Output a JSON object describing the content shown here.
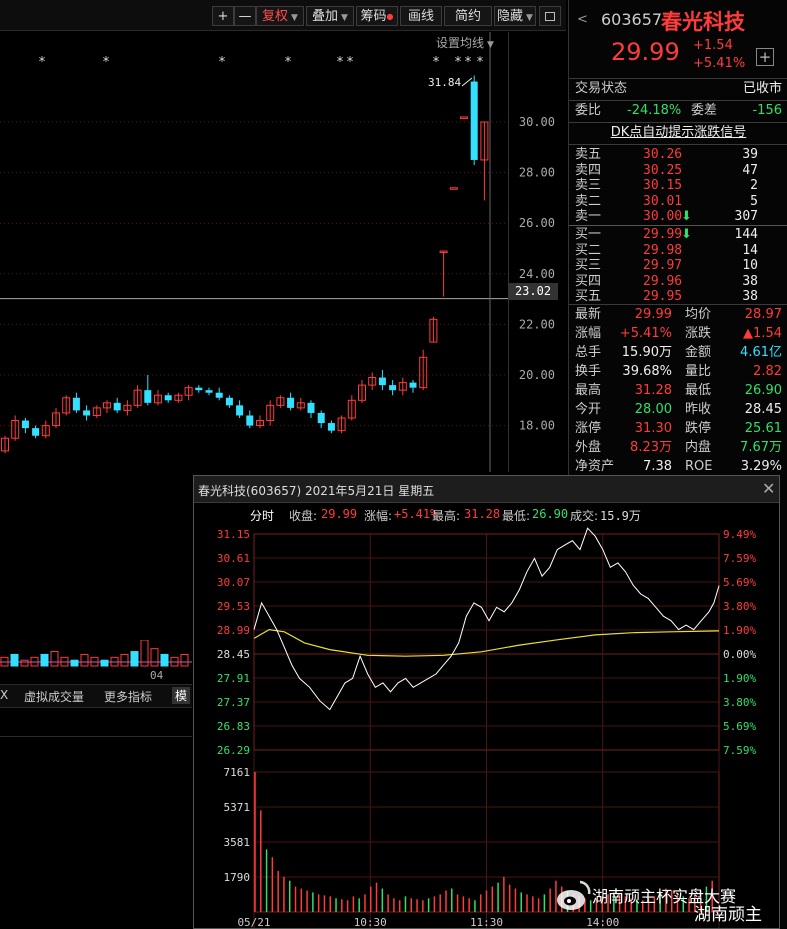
{
  "toolbar": {
    "plus_label": "+",
    "minus_label": "—",
    "fuquan_label": "复权",
    "diejia_label": "叠加",
    "chouma_label": "筹码",
    "huaxian_label": "画线",
    "jianyue_label": "简约",
    "yincang_label": "隐藏"
  },
  "kchart": {
    "settings_label": "设置均线",
    "max_marker": "31.84",
    "y_ticks": [
      "30.00",
      "28.00",
      "26.00",
      "24.00",
      "22.00",
      "20.00",
      "18.00"
    ],
    "crosshair_value": "23.02",
    "star_glyph": "*",
    "volume_x_label": "04",
    "candles": [
      {
        "o": 17.0,
        "c": 17.5,
        "h": 17.6,
        "l": 16.9
      },
      {
        "o": 17.5,
        "c": 18.2,
        "h": 18.4,
        "l": 17.4
      },
      {
        "o": 18.2,
        "c": 17.9,
        "h": 18.3,
        "l": 17.7
      },
      {
        "o": 17.9,
        "c": 17.6,
        "h": 18.0,
        "l": 17.5
      },
      {
        "o": 17.6,
        "c": 18.0,
        "h": 18.2,
        "l": 17.5
      },
      {
        "o": 18.0,
        "c": 18.5,
        "h": 18.7,
        "l": 17.9
      },
      {
        "o": 18.5,
        "c": 19.1,
        "h": 19.2,
        "l": 18.4
      },
      {
        "o": 19.1,
        "c": 18.6,
        "h": 19.3,
        "l": 18.5
      },
      {
        "o": 18.6,
        "c": 18.4,
        "h": 18.8,
        "l": 18.2
      },
      {
        "o": 18.4,
        "c": 18.7,
        "h": 18.8,
        "l": 18.3
      },
      {
        "o": 18.7,
        "c": 18.9,
        "h": 19.0,
        "l": 18.5
      },
      {
        "o": 18.9,
        "c": 18.6,
        "h": 19.1,
        "l": 18.5
      },
      {
        "o": 18.6,
        "c": 18.8,
        "h": 19.0,
        "l": 18.4
      },
      {
        "o": 18.8,
        "c": 19.4,
        "h": 19.6,
        "l": 18.7
      },
      {
        "o": 19.4,
        "c": 18.9,
        "h": 20.0,
        "l": 18.8
      },
      {
        "o": 18.9,
        "c": 19.2,
        "h": 19.4,
        "l": 18.8
      },
      {
        "o": 19.2,
        "c": 19.0,
        "h": 19.3,
        "l": 18.9
      },
      {
        "o": 19.0,
        "c": 19.2,
        "h": 19.3,
        "l": 18.9
      },
      {
        "o": 19.2,
        "c": 19.5,
        "h": 19.6,
        "l": 19.0
      },
      {
        "o": 19.5,
        "c": 19.4,
        "h": 19.6,
        "l": 19.3
      },
      {
        "o": 19.4,
        "c": 19.3,
        "h": 19.5,
        "l": 19.2
      },
      {
        "o": 19.3,
        "c": 19.1,
        "h": 19.5,
        "l": 19.0
      },
      {
        "o": 19.1,
        "c": 18.8,
        "h": 19.2,
        "l": 18.7
      },
      {
        "o": 18.8,
        "c": 18.4,
        "h": 19.0,
        "l": 18.3
      },
      {
        "o": 18.4,
        "c": 18.0,
        "h": 18.6,
        "l": 17.9
      },
      {
        "o": 18.0,
        "c": 18.2,
        "h": 18.4,
        "l": 17.9
      },
      {
        "o": 18.2,
        "c": 18.8,
        "h": 19.0,
        "l": 18.0
      },
      {
        "o": 18.8,
        "c": 19.1,
        "h": 19.2,
        "l": 18.7
      },
      {
        "o": 19.1,
        "c": 18.7,
        "h": 19.3,
        "l": 18.6
      },
      {
        "o": 18.7,
        "c": 18.9,
        "h": 19.1,
        "l": 18.6
      },
      {
        "o": 18.9,
        "c": 18.5,
        "h": 19.0,
        "l": 18.3
      },
      {
        "o": 18.5,
        "c": 18.1,
        "h": 18.6,
        "l": 17.9
      },
      {
        "o": 18.1,
        "c": 17.8,
        "h": 18.2,
        "l": 17.7
      },
      {
        "o": 17.8,
        "c": 18.3,
        "h": 18.4,
        "l": 17.7
      },
      {
        "o": 18.3,
        "c": 19.0,
        "h": 19.2,
        "l": 18.2
      },
      {
        "o": 19.0,
        "c": 19.6,
        "h": 19.8,
        "l": 18.9
      },
      {
        "o": 19.6,
        "c": 19.9,
        "h": 20.1,
        "l": 19.4
      },
      {
        "o": 19.9,
        "c": 19.6,
        "h": 20.2,
        "l": 19.4
      },
      {
        "o": 19.6,
        "c": 19.4,
        "h": 19.8,
        "l": 19.2
      },
      {
        "o": 19.4,
        "c": 19.7,
        "h": 19.9,
        "l": 19.2
      },
      {
        "o": 19.7,
        "c": 19.5,
        "h": 19.8,
        "l": 19.3
      },
      {
        "o": 19.5,
        "c": 20.7,
        "h": 21.0,
        "l": 19.4
      },
      {
        "o": 21.3,
        "c": 22.2,
        "h": 22.3,
        "l": 21.3
      },
      {
        "o": 24.9,
        "c": 24.9,
        "h": 24.9,
        "l": 23.1
      },
      {
        "o": 27.4,
        "c": 27.4,
        "h": 27.4,
        "l": 27.4
      },
      {
        "o": 30.2,
        "c": 30.2,
        "h": 30.2,
        "l": 30.2
      },
      {
        "o": 31.6,
        "c": 28.5,
        "h": 31.84,
        "l": 28.3
      },
      {
        "o": 28.5,
        "c": 30.0,
        "h": 30.0,
        "l": 26.9
      }
    ],
    "volume_bars": [
      3,
      4,
      2,
      3,
      4,
      5,
      3,
      2,
      4,
      3,
      2,
      3,
      4,
      5,
      9,
      6,
      4,
      3,
      4,
      3,
      2,
      3,
      4,
      2,
      3,
      4,
      3,
      2,
      3,
      4,
      2,
      3,
      2,
      4,
      5,
      4,
      3,
      2,
      3,
      4,
      3,
      5,
      6,
      4,
      3,
      5,
      7,
      6
    ]
  },
  "bottom_tabs": {
    "x_label": "X",
    "vvol_label": "虚拟成交量",
    "more_label": "更多指标",
    "mo_label": "模"
  },
  "quote": {
    "code": "603657",
    "name": "春光科技",
    "price": "29.99",
    "change": "+1.54",
    "change_pct": "+5.41%",
    "status_label": "交易状态",
    "status_value": "已收市",
    "weibi_label": "委比",
    "weibi_value": "-24.18%",
    "weicha_label": "委差",
    "weicha_value": "-156",
    "signal_label": "DK点自动提示涨跌信号",
    "asks": [
      {
        "label": "卖五",
        "price": "30.26",
        "vol": "39"
      },
      {
        "label": "卖四",
        "price": "30.25",
        "vol": "47"
      },
      {
        "label": "卖三",
        "price": "30.15",
        "vol": "2"
      },
      {
        "label": "卖二",
        "price": "30.01",
        "vol": "5"
      },
      {
        "label": "卖一",
        "price": "30.00",
        "vol": "307"
      }
    ],
    "bids": [
      {
        "label": "买一",
        "price": "29.99",
        "vol": "144"
      },
      {
        "label": "买二",
        "price": "29.98",
        "vol": "14"
      },
      {
        "label": "买三",
        "price": "29.97",
        "vol": "10"
      },
      {
        "label": "买四",
        "price": "29.96",
        "vol": "38"
      },
      {
        "label": "买五",
        "price": "29.95",
        "vol": "38"
      }
    ],
    "stats": [
      {
        "l1": "最新",
        "v1": "29.99",
        "c1": "red",
        "l2": "均价",
        "v2": "28.97",
        "c2": "red"
      },
      {
        "l1": "涨幅",
        "v1": "+5.41%",
        "c1": "red",
        "l2": "涨跌",
        "v2": "▲1.54",
        "c2": "red"
      },
      {
        "l1": "总手",
        "v1": "15.90万",
        "c1": "white",
        "l2": "金额",
        "v2": "4.61亿",
        "c2": "cyan"
      },
      {
        "l1": "换手",
        "v1": "39.68%",
        "c1": "white",
        "l2": "量比",
        "v2": "2.82",
        "c2": "red"
      },
      {
        "l1": "最高",
        "v1": "31.28",
        "c1": "red",
        "l2": "最低",
        "v2": "26.90",
        "c2": "green"
      },
      {
        "l1": "今开",
        "v1": "28.00",
        "c1": "green",
        "l2": "昨收",
        "v2": "28.45",
        "c2": "white"
      },
      {
        "l1": "涨停",
        "v1": "31.30",
        "c1": "red",
        "l2": "跌停",
        "v2": "25.61",
        "c2": "green"
      },
      {
        "l1": "外盘",
        "v1": "8.23万",
        "c1": "red",
        "l2": "内盘",
        "v2": "7.67万",
        "c2": "green"
      },
      {
        "l1": "净资产",
        "v1": "7.38",
        "c1": "white",
        "l2": "ROE",
        "v2": "3.29%",
        "c2": "white"
      }
    ]
  },
  "popup": {
    "title": "春光科技(603657) 2021年5月21日 星期五",
    "fenshi_label": "分时",
    "close_label": "收盘:",
    "close_value": "29.99",
    "change_label": "涨幅:",
    "change_value": "+5.41%",
    "high_label": "最高:",
    "high_value": "31.28",
    "low_label": "最低:",
    "low_value": "26.90",
    "vol_label": "成交:",
    "vol_value": "15.9万",
    "left_ticks": [
      {
        "t": "31.15",
        "c": "red"
      },
      {
        "t": "30.61",
        "c": "red"
      },
      {
        "t": "30.07",
        "c": "red"
      },
      {
        "t": "29.53",
        "c": "red"
      },
      {
        "t": "28.99",
        "c": "red"
      },
      {
        "t": "28.45",
        "c": "white"
      },
      {
        "t": "27.91",
        "c": "green"
      },
      {
        "t": "27.37",
        "c": "green"
      },
      {
        "t": "26.83",
        "c": "green"
      },
      {
        "t": "26.29",
        "c": "green"
      }
    ],
    "right_ticks": [
      {
        "t": "9.49%",
        "c": "red"
      },
      {
        "t": "7.59%",
        "c": "red"
      },
      {
        "t": "5.69%",
        "c": "red"
      },
      {
        "t": "3.80%",
        "c": "red"
      },
      {
        "t": "1.90%",
        "c": "red"
      },
      {
        "t": "0.00%",
        "c": "white"
      },
      {
        "t": "1.90%",
        "c": "green"
      },
      {
        "t": "3.80%",
        "c": "green"
      },
      {
        "t": "5.69%",
        "c": "green"
      },
      {
        "t": "7.59%",
        "c": "green"
      }
    ],
    "vol_ticks": [
      "7161",
      "5371",
      "3581",
      "1790"
    ],
    "time_ticks": [
      "05/21",
      "10:30",
      "11:30",
      "14:00"
    ],
    "price_path": [
      [
        0,
        29.0
      ],
      [
        3,
        29.6
      ],
      [
        6,
        29.3
      ],
      [
        9,
        29.0
      ],
      [
        12,
        28.6
      ],
      [
        15,
        28.2
      ],
      [
        18,
        27.9
      ],
      [
        22,
        27.7
      ],
      [
        26,
        27.4
      ],
      [
        30,
        27.2
      ],
      [
        33,
        27.5
      ],
      [
        36,
        27.8
      ],
      [
        39,
        27.9
      ],
      [
        42,
        28.4
      ],
      [
        45,
        28.0
      ],
      [
        48,
        27.7
      ],
      [
        51,
        27.8
      ],
      [
        54,
        27.6
      ],
      [
        57,
        27.8
      ],
      [
        60,
        27.9
      ],
      [
        63,
        27.7
      ],
      [
        66,
        27.8
      ],
      [
        69,
        27.9
      ],
      [
        72,
        28.0
      ],
      [
        75,
        28.2
      ],
      [
        78,
        28.4
      ],
      [
        81,
        28.7
      ],
      [
        84,
        29.3
      ],
      [
        87,
        29.6
      ],
      [
        90,
        29.5
      ],
      [
        93,
        29.2
      ],
      [
        96,
        29.5
      ],
      [
        99,
        29.4
      ],
      [
        102,
        29.6
      ],
      [
        105,
        29.9
      ],
      [
        108,
        30.3
      ],
      [
        111,
        30.6
      ],
      [
        114,
        30.2
      ],
      [
        117,
        30.4
      ],
      [
        120,
        30.8
      ],
      [
        123,
        30.9
      ],
      [
        126,
        31.0
      ],
      [
        129,
        30.8
      ],
      [
        132,
        31.28
      ],
      [
        135,
        31.1
      ],
      [
        138,
        30.8
      ],
      [
        141,
        30.4
      ],
      [
        144,
        30.5
      ],
      [
        147,
        30.3
      ],
      [
        150,
        30.0
      ],
      [
        153,
        29.8
      ],
      [
        156,
        29.7
      ],
      [
        159,
        29.5
      ],
      [
        162,
        29.3
      ],
      [
        165,
        29.2
      ],
      [
        168,
        29.0
      ],
      [
        171,
        29.1
      ],
      [
        174,
        29.0
      ],
      [
        177,
        29.2
      ],
      [
        180,
        29.4
      ],
      [
        182,
        29.6
      ],
      [
        184,
        29.99
      ]
    ],
    "avg_path": [
      [
        0,
        28.8
      ],
      [
        6,
        29.0
      ],
      [
        12,
        28.95
      ],
      [
        20,
        28.7
      ],
      [
        30,
        28.55
      ],
      [
        45,
        28.42
      ],
      [
        60,
        28.4
      ],
      [
        75,
        28.42
      ],
      [
        90,
        28.5
      ],
      [
        105,
        28.65
      ],
      [
        120,
        28.77
      ],
      [
        135,
        28.88
      ],
      [
        150,
        28.93
      ],
      [
        165,
        28.95
      ],
      [
        184,
        28.97
      ]
    ],
    "volume_bars": [
      7161,
      5200,
      3200,
      2800,
      2100,
      1800,
      1600,
      1300,
      1200,
      1100,
      1000,
      900,
      850,
      800,
      700,
      650,
      600,
      800,
      700,
      900,
      1300,
      1500,
      1200,
      900,
      700,
      600,
      800,
      700,
      650,
      600,
      700,
      800,
      900,
      1100,
      1200,
      900,
      800,
      700,
      600,
      900,
      1100,
      1300,
      1500,
      1800,
      1400,
      1200,
      1000,
      900,
      800,
      700,
      900,
      1200,
      1600,
      1300,
      1100,
      900,
      800,
      700,
      600,
      700,
      800,
      900,
      1000,
      900,
      800,
      700,
      650,
      600,
      700,
      800,
      1000,
      1200,
      1100,
      900,
      800,
      700,
      900,
      1100,
      1300,
      1600
    ]
  },
  "watermark": {
    "line1": "湖南顽主杯实盘大赛",
    "line2": "湖南顽主"
  },
  "colors": {
    "up": "#ff3b3b",
    "down": "#33e0ff",
    "avg": "#e8e033",
    "grid": "#3a1010"
  }
}
